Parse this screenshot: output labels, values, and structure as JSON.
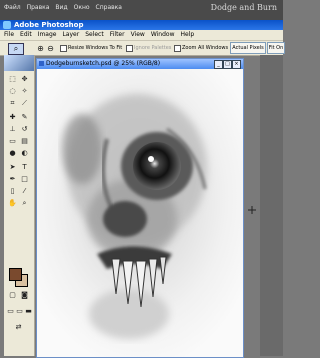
{
  "header": {
    "menus": [
      "Файл",
      "Правка",
      "Вид",
      "Окно",
      "Справка"
    ],
    "title": "Dodge and Burn"
  },
  "app": {
    "title": "Adobe Photoshop"
  },
  "menubar": [
    "File",
    "Edit",
    "Image",
    "Layer",
    "Select",
    "Filter",
    "View",
    "Window",
    "Help"
  ],
  "options": {
    "resize_label": "Resize Windows To Fit",
    "ignore_label": "Ignore Palettes",
    "zoom_all_label": "Zoom All Windows",
    "actual_pixels": "Actual Pixels",
    "fit_on": "Fit On"
  },
  "document": {
    "title": "Dodgeburnsketch.psd @ 25% (RGB/8)"
  },
  "colors": {
    "foreground": "#7a4a2e",
    "background": "#d9c1a1",
    "titlebar": "#2b76e8"
  }
}
